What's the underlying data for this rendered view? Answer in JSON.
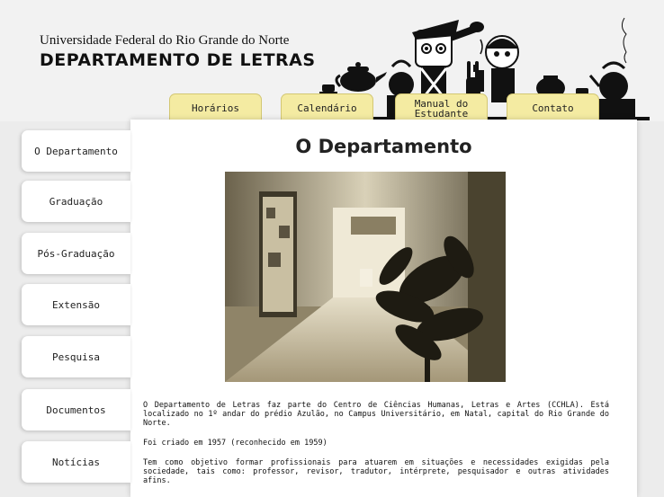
{
  "header": {
    "university": "Universidade Federal do Rio Grande do Norte",
    "department": "DEPARTAMENTO DE LETRAS"
  },
  "tabs": [
    "Horários",
    "Calendário",
    "Manual do Estudante",
    "Contato"
  ],
  "sidebar": [
    "O Departamento",
    "Graduação",
    "Pós-Graduação",
    "Extensão",
    "Pesquisa",
    "Documentos",
    "Notícias"
  ],
  "main": {
    "title": "O Departamento",
    "paragraphs": [
      "O Departamento de Letras faz parte do Centro de Ciências Humanas, Letras e Artes (CCHLA). Está localizado no 1º andar do prédio Azulão, no Campus Universitário, em Natal, capital do Rio Grande do Norte.",
      "Foi criado em 1957 (reconhecido em 1959)",
      "Tem como objetivo formar profissionais para atuarem em situações e necessidades exigidas pela sociedade, tais como: professor, revisor, tradutor, intérprete, pesquisador e outras atividades afins."
    ]
  },
  "colors": {
    "tab_bg": "#f4eba2",
    "page_bg": "#ececec",
    "photo_tone": "#b7a884"
  }
}
